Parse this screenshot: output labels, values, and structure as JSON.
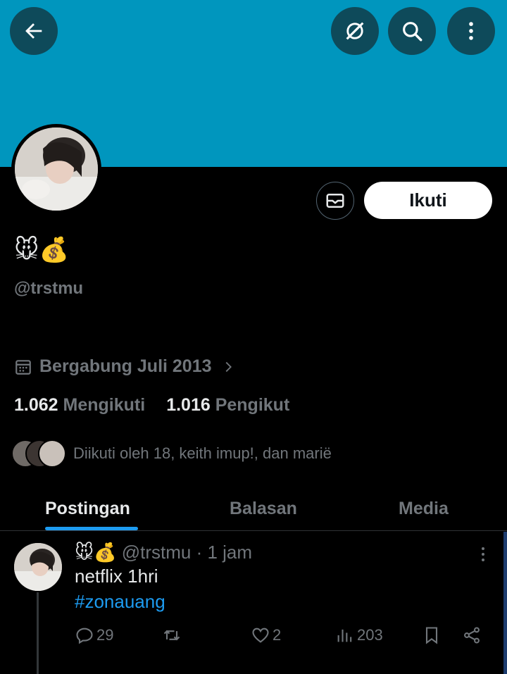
{
  "header": {
    "back_icon": "arrow-left-icon",
    "grok_icon": "grok-slash-icon",
    "search_icon": "search-icon",
    "more_icon": "more-vertical-icon"
  },
  "profile": {
    "display_name": "🐭💰",
    "handle": "@trstmu",
    "joined": "Bergabung Juli 2013",
    "following_count": "1.062",
    "following_label": "Mengikuti",
    "followers_count": "1.016",
    "followers_label": "Pengikut",
    "followed_by": "Diikuti oleh 18, keith imup!, dan marië",
    "follow_label": "Ikuti",
    "message_icon": "mail-icon"
  },
  "tabs": [
    {
      "label": "Postingan",
      "active": true
    },
    {
      "label": "Balasan",
      "active": false
    },
    {
      "label": "Media",
      "active": false
    }
  ],
  "tweet": {
    "name": "🐭💰",
    "handle": "@trstmu",
    "time": "· 1 jam",
    "text": "netflix 1hri",
    "hashtag": "#zonauang",
    "replies": "29",
    "retweets": "",
    "likes": "2",
    "views": "203"
  },
  "colors": {
    "banner": "#0096be",
    "accent": "#1d9bf0",
    "background": "#000000",
    "muted": "#71767b"
  }
}
